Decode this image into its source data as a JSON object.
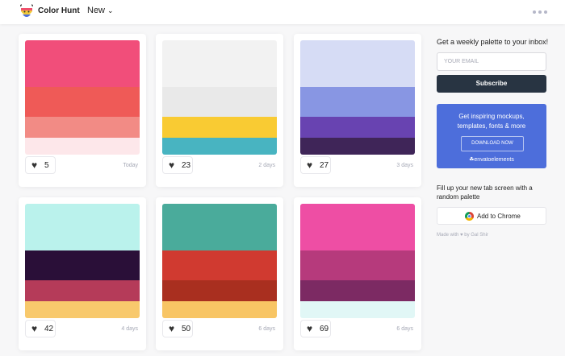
{
  "header": {
    "brand": "Color Hunt",
    "nav_new": "New",
    "logo_icon": "color-hunt-logo",
    "chevron_icon": "chevron-down-icon",
    "more_icon": "more-dots-icon"
  },
  "palettes": [
    {
      "colors": [
        "#f14e7a",
        "#ef5a57",
        "#f28b85",
        "#fde7ea"
      ],
      "likes": "5",
      "date": "Today"
    },
    {
      "colors": [
        "#f2f2f2",
        "#e9e9e9",
        "#f9cb33",
        "#48b4c1"
      ],
      "likes": "23",
      "date": "2 days"
    },
    {
      "colors": [
        "#d6dcf5",
        "#8896e3",
        "#6843b1",
        "#3f2558"
      ],
      "likes": "27",
      "date": "3 days"
    },
    {
      "colors": [
        "#baf2ec",
        "#2a0f38",
        "#b53b59",
        "#f8c96c"
      ],
      "likes": "42",
      "date": "4 days"
    },
    {
      "colors": [
        "#4aab9b",
        "#d03a30",
        "#a92f1f",
        "#f8c564"
      ],
      "likes": "50",
      "date": "6 days"
    },
    {
      "colors": [
        "#ee4ea4",
        "#b63a7c",
        "#7c2a63",
        "#e1f7f6"
      ],
      "likes": "69",
      "date": "6 days"
    }
  ],
  "sidebar": {
    "newsletter_title": "Get a weekly palette to your inbox!",
    "email_placeholder": "YOUR EMAIL",
    "subscribe_label": "Subscribe",
    "promo_line1": "Get inspiring mockups,",
    "promo_line2": "templates, fonts & more",
    "promo_button": "DOWNLOAD NOW",
    "promo_brand": "☘envatoelements",
    "ntp_line1": "Fill up your new tab screen with a",
    "ntp_line2": "random palette",
    "chrome_label": "Add to Chrome",
    "made_with": "Made with ♥ by Gal Shir"
  },
  "colors": {
    "header_bg": "#ffffff",
    "page_bg": "#f7f7f8",
    "subscribe_bg": "#283442",
    "promo_bg": "#4d6edb"
  }
}
